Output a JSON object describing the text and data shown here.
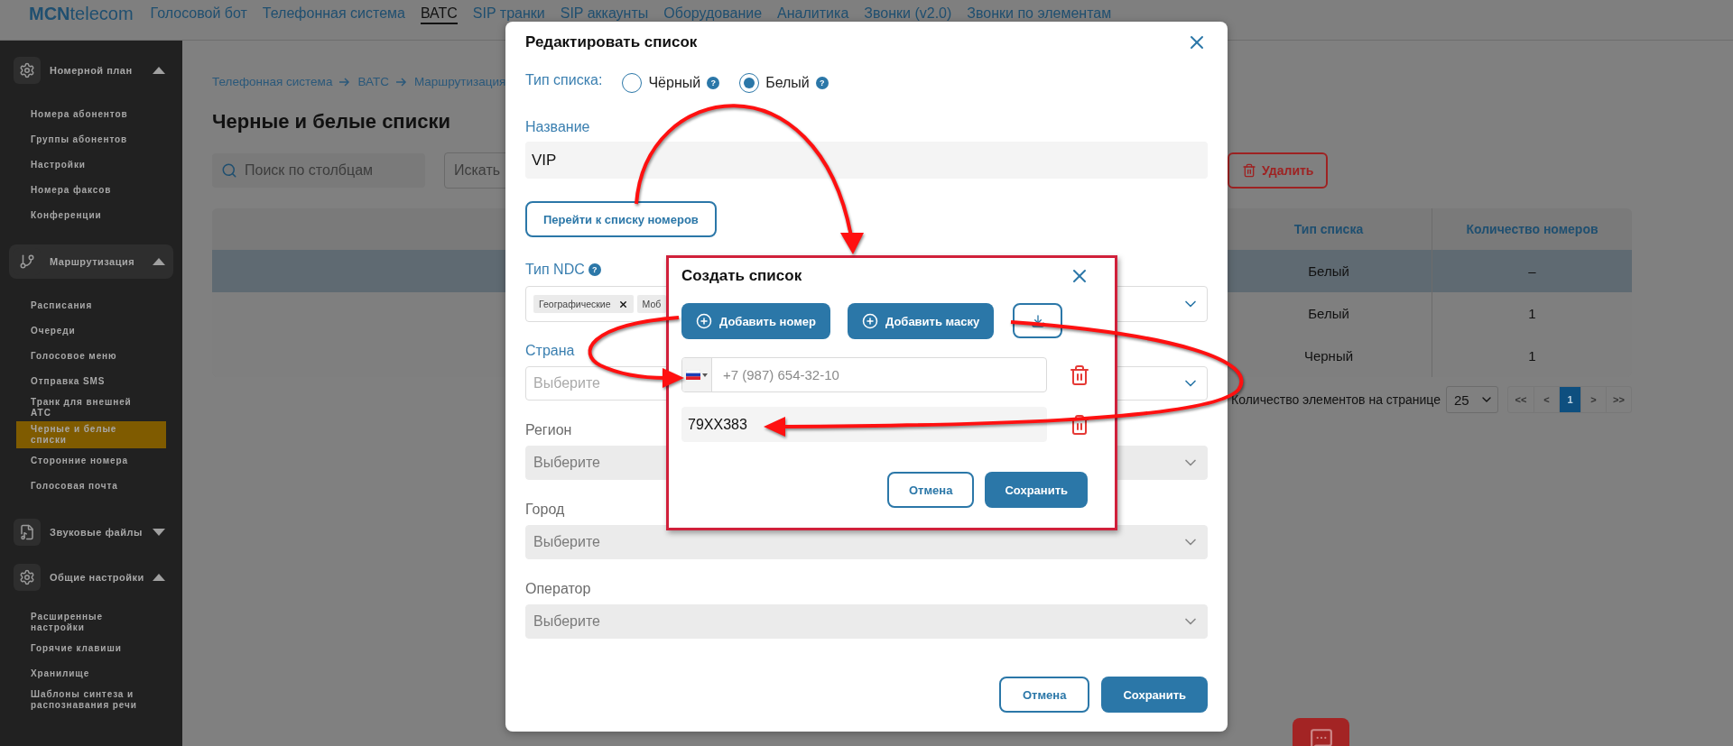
{
  "header": {
    "logo": "**MCN**telecom",
    "nav": [
      {
        "label": "Голосовой бот",
        "selected": false
      },
      {
        "label": "Телефонная система",
        "selected": false
      },
      {
        "label": "ВАТС",
        "selected": true
      },
      {
        "label": "SIP транки",
        "selected": false
      },
      {
        "label": "SIP аккаунты",
        "selected": false
      },
      {
        "label": "Оборудование",
        "selected": false
      },
      {
        "label": "Аналитика",
        "selected": false
      },
      {
        "label": "Звонки (v2.0)",
        "selected": false
      },
      {
        "label": "Звонки по элементам",
        "selected": false
      }
    ]
  },
  "sidebar": {
    "groups": [
      {
        "title": "Номерной план",
        "expanded": true,
        "selected": false,
        "items": [
          {
            "label": "Номера абонентов",
            "selected": false
          },
          {
            "label": "Группы абонентов",
            "selected": false
          },
          {
            "label": "Настройки",
            "selected": false
          },
          {
            "label": "Номера факсов",
            "selected": false
          },
          {
            "label": "Конференции",
            "selected": false
          }
        ]
      },
      {
        "title": "Маршрутизация",
        "expanded": true,
        "selected": true,
        "items": [
          {
            "label": "Расписания",
            "selected": false
          },
          {
            "label": "Очереди",
            "selected": false
          },
          {
            "label": "Голосовое меню",
            "selected": false
          },
          {
            "label": "Отправка SMS",
            "selected": false
          },
          {
            "label": "Транк для внешней АТС",
            "selected": false
          },
          {
            "label": "Черные и белые списки",
            "selected": true
          },
          {
            "label": "Сторонние номера",
            "selected": false
          },
          {
            "label": "Голосовая почта",
            "selected": false
          }
        ]
      },
      {
        "title": "Звуковые файлы",
        "expanded": false,
        "selected": false
      },
      {
        "title": "Общие настройки",
        "expanded": true,
        "selected": false,
        "items": [
          {
            "label": "Расширенные настройки",
            "selected": false
          },
          {
            "label": "Горячие клавиши",
            "selected": false
          },
          {
            "label": "Хранилище",
            "selected": false
          },
          {
            "label": "Шаблоны синтеза и распознавания речи",
            "selected": false
          }
        ]
      }
    ]
  },
  "main": {
    "breadcrumb": [
      "Телефонная система",
      "ВАТС",
      "Маршрутизация"
    ],
    "title": "Черные и белые списки",
    "search": {
      "placeholder": "Поиск по столбцам"
    },
    "find_field": {
      "placeholder": "Искать"
    },
    "delete_button": "Удалить",
    "table": {
      "columns": [
        "",
        "Тип списка",
        "Количество номеров"
      ],
      "rows": [
        {
          "selected": true,
          "cells": [
            "",
            "Белый",
            "–"
          ]
        },
        {
          "selected": false,
          "cells": [
            "",
            "Белый",
            "1"
          ]
        },
        {
          "selected": false,
          "cells": [
            "",
            "Черный",
            "1"
          ]
        }
      ]
    },
    "pagination": {
      "label": "Количество элементов на странице",
      "page_size": "25",
      "pages": [
        {
          "label": "<<",
          "selected": false
        },
        {
          "label": "<",
          "selected": false
        },
        {
          "label": "1",
          "selected": true
        },
        {
          "label": ">",
          "selected": false
        },
        {
          "label": ">>",
          "selected": false
        }
      ]
    }
  },
  "edit_dialog": {
    "title": "Редактировать список",
    "list_type": {
      "label": "Тип списка:",
      "options": [
        {
          "label": "Чёрный",
          "selected": false,
          "help": "?"
        },
        {
          "label": "Белый",
          "selected": true,
          "help": "?"
        }
      ]
    },
    "name": {
      "label": "Название",
      "value": "VIP"
    },
    "go_button": "Перейти к списку номеров",
    "ndc": {
      "label": "Тип NDC",
      "help": "?",
      "tags": [
        "Географические",
        "Моб"
      ]
    },
    "selects": [
      {
        "label": "Страна",
        "placeholder": "Выберите",
        "disabled": false
      },
      {
        "label": "Регион",
        "placeholder": "Выберите",
        "disabled": true
      },
      {
        "label": "Город",
        "placeholder": "Выберите",
        "disabled": true
      },
      {
        "label": "Оператор",
        "placeholder": "Выберите",
        "disabled": true
      }
    ],
    "buttons": [
      {
        "label": "Отмена",
        "kind": "secondary"
      },
      {
        "label": "Сохранить",
        "kind": "primary"
      }
    ]
  },
  "create_dialog": {
    "title": "Создать список",
    "add_buttons": [
      "Добавить номер",
      "Добавить маску"
    ],
    "entries": [
      {
        "kind": "phone",
        "placeholder": "+7 (987) 654-32-10"
      },
      {
        "kind": "mask",
        "value": "79XX383"
      }
    ],
    "buttons": [
      {
        "label": "Отмена",
        "kind": "secondary"
      },
      {
        "label": "Сохранить",
        "kind": "primary"
      }
    ]
  }
}
